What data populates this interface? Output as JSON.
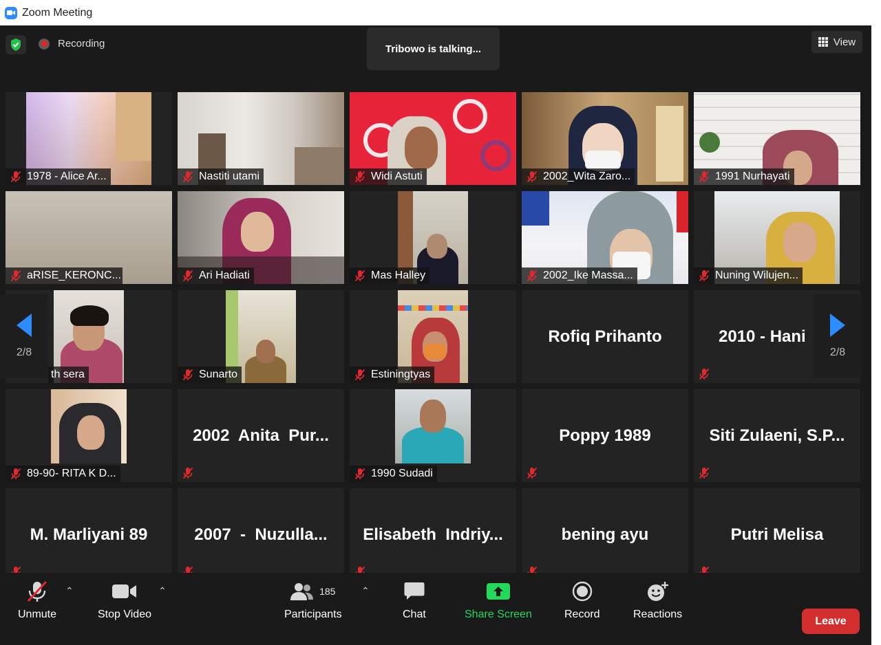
{
  "window": {
    "title": "Zoom Meeting"
  },
  "top": {
    "recording_label": "Recording",
    "talking_text": "Tribowo is talking...",
    "view_label": "View"
  },
  "pager": {
    "left": "2/8",
    "right": "2/8"
  },
  "tiles": [
    {
      "name": "1978 - Alice Ar...",
      "video": true
    },
    {
      "name": "Nastiti utami",
      "video": true
    },
    {
      "name": "Widi Astuti",
      "video": true
    },
    {
      "name": "2002_Wita Zaro...",
      "video": true
    },
    {
      "name": "1991 Nurhayati",
      "video": true
    },
    {
      "name": "aRISE_KERONC...",
      "video": true
    },
    {
      "name": "Ari Hadiati",
      "video": true
    },
    {
      "name": "Mas Halley",
      "video": true
    },
    {
      "name": "2002_Ike Massa...",
      "video": true
    },
    {
      "name": "Nuning Wilujen...",
      "video": true
    },
    {
      "name": "th sera",
      "video": true
    },
    {
      "name": "Sunarto",
      "video": true
    },
    {
      "name": "Estiningtyas",
      "video": true
    },
    {
      "name": "Rofiq Prihanto",
      "video": false
    },
    {
      "name": "2010 - Hani",
      "video": false
    },
    {
      "name": "89-90- RITA K D...",
      "video": true
    },
    {
      "name": "2002  Anita  Pur...",
      "video": false
    },
    {
      "name": "1990 Sudadi",
      "video": true
    },
    {
      "name": "Poppy 1989",
      "video": false
    },
    {
      "name": "Siti Zulaeni, S.P...",
      "video": false
    },
    {
      "name": "M. Marliyani 89",
      "video": false
    },
    {
      "name": "2007  -  Nuzulla...",
      "video": false
    },
    {
      "name": "Elisabeth  Indriy...",
      "video": false
    },
    {
      "name": "bening ayu",
      "video": false
    },
    {
      "name": "Putri Melisa",
      "video": false
    }
  ],
  "toolbar": {
    "unmute": "Unmute",
    "stop_video": "Stop Video",
    "participants": "Participants",
    "participants_count": "185",
    "chat": "Chat",
    "share_screen": "Share Screen",
    "record": "Record",
    "reactions": "Reactions",
    "leave": "Leave"
  },
  "colors": {
    "background": "#1a1a1a",
    "tile": "#232323",
    "share_green": "#23d959",
    "leave_red": "#d32f2f",
    "mic_off_red": "#e0282f",
    "nav_blue": "#2d8cff"
  }
}
